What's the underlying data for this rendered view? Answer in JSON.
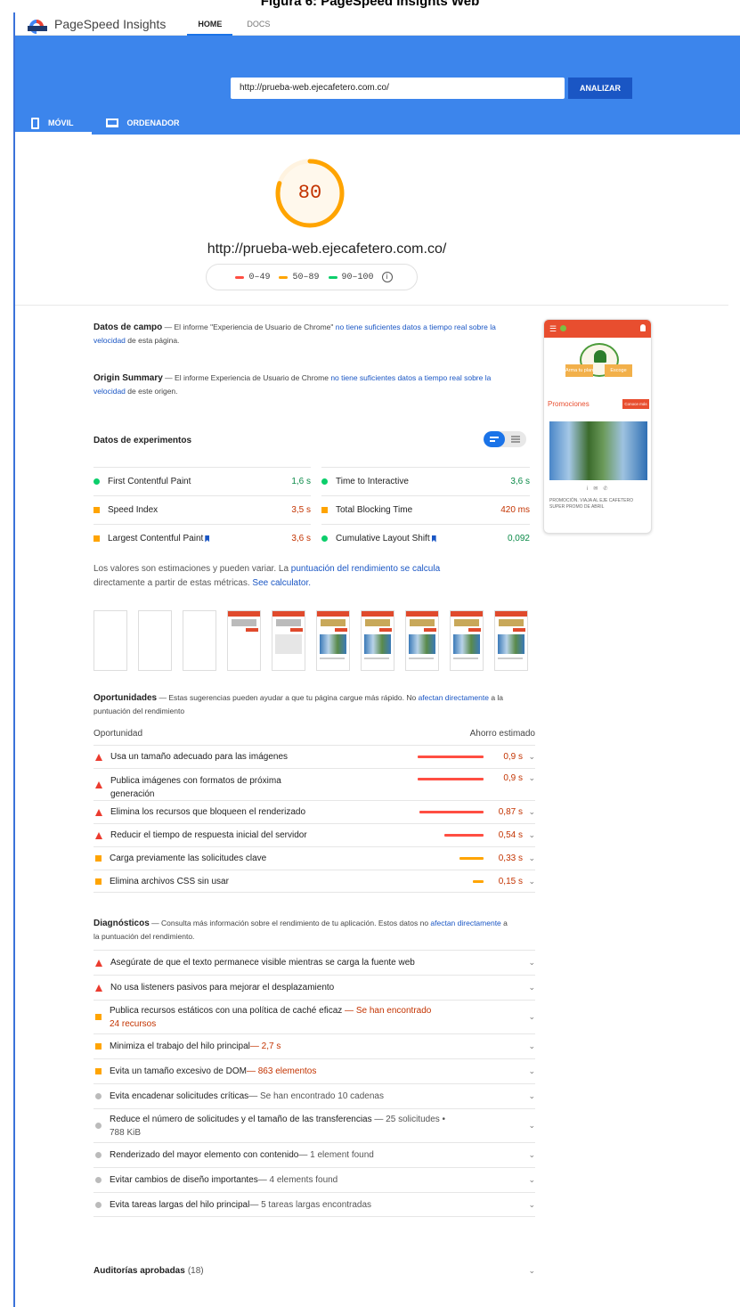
{
  "caption": "Figura 6: PageSpeed Insights Web",
  "topbar": {
    "brand": "PageSpeed Insights",
    "home": "HOME",
    "docs": "DOCS"
  },
  "search": {
    "value": "http://prueba-web.ejecafetero.com.co/",
    "button": "ANALIZAR"
  },
  "device_tabs": [
    {
      "label": "MÓVIL"
    },
    {
      "label": "ORDENADOR"
    }
  ],
  "score": {
    "value": "80",
    "fraction": 0.8,
    "color": "#ffa400",
    "url": "http://prueba-web.ejecafetero.com.co/"
  },
  "legend": [
    {
      "label": "0–49",
      "color": "#ff4e42"
    },
    {
      "label": "50–89",
      "color": "#ffa400"
    },
    {
      "label": "90–100",
      "color": "#0cce6b"
    }
  ],
  "field": {
    "title": "Datos de campo",
    "dash": " — El informe \"Experiencia de Usuario de Chrome\" ",
    "link": "no tiene suficientes datos a tiempo real sobre la velocidad",
    "tail": " de esta página."
  },
  "origin": {
    "title": "Origin Summary",
    "dash": " — El informe Experiencia de Usuario de Chrome ",
    "link": "no tiene suficientes datos a tiempo real sobre la velocidad",
    "tail": " de este origen."
  },
  "lab": {
    "title": "Datos de experimentos",
    "metrics": [
      {
        "label": "First Contentful Paint",
        "value": "1,6 s"
      },
      {
        "label": "Time to Interactive",
        "value": "3,6 s"
      },
      {
        "label": "Speed Index",
        "value": "3,5 s"
      },
      {
        "label": "Total Blocking Time",
        "value": "420 ms"
      },
      {
        "label": "Largest Contentful Paint",
        "value": "3,6 s"
      },
      {
        "label": "Cumulative Layout Shift",
        "value": "0,092"
      }
    ],
    "note1": "Los valores son estimaciones y pueden variar. La ",
    "note_link": "puntuación del rendimiento se calcula",
    "note2": "directamente a partir de estas métricas. ",
    "calc_link": "See calculator."
  },
  "opportunities": {
    "title": "Oportunidades",
    "desc": " — Estas sugerencias pueden ayudar a que tu página cargue más rápido. No ",
    "link": "afectan directamente",
    "tail": " a la puntuación del rendimiento",
    "col1": "Oportunidad",
    "col2": "Ahorro estimado",
    "items": [
      {
        "label": "Usa un tamaño adecuado para las imágenes",
        "saving": "0,9 s",
        "savings_s": 0.9
      },
      {
        "label": "Publica imágenes con formatos de próxima",
        "label2": "generación",
        "saving": "0,9 s",
        "savings_s": 0.9
      },
      {
        "label": "Elimina los recursos que bloqueen el renderizado",
        "saving": "0,87 s",
        "savings_s": 0.87
      },
      {
        "label": "Reducir el tiempo de respuesta inicial del servidor",
        "saving": "0,54 s",
        "savings_s": 0.54
      },
      {
        "label": "Carga previamente las solicitudes clave",
        "saving": "0,33 s",
        "savings_s": 0.33
      },
      {
        "label": "Elimina archivos CSS sin usar",
        "saving": "0,15 s",
        "savings_s": 0.15
      }
    ]
  },
  "diagnostics": {
    "title": "Diagnósticos",
    "desc": " — Consulta más información sobre el rendimiento de tu aplicación. Estos datos no ",
    "link": "afectan directamente",
    "tail": " a la puntuación del rendimiento.",
    "items": [
      {
        "label": "Asegúrate de que el texto permanece visible mientras se carga la fuente web"
      },
      {
        "label": "No usa listeners pasivos para mejorar el desplazamiento"
      },
      {
        "label": "Publica recursos estáticos con una política de caché eficaz",
        "note": " — Se han encontrado",
        "note2": "24 recursos"
      },
      {
        "label": "Minimiza el trabajo del hilo principal",
        "note": " — 2,7 s"
      },
      {
        "label": "Evita un tamaño excesivo de DOM",
        "note": " — 863 elementos"
      },
      {
        "label": "Evita encadenar solicitudes críticas",
        "note": " — Se han encontrado 10 cadenas"
      },
      {
        "label": "Reduce el número de solicitudes y el tamaño de las transferencias",
        "note": " — 25 solicitudes •",
        "note2": "788 KiB"
      },
      {
        "label": "Renderizado del mayor elemento con contenido",
        "note": " — 1 element found"
      },
      {
        "label": "Evitar cambios de diseño importantes",
        "note": " — 4 elements found"
      },
      {
        "label": "Evita tareas largas del hilo principal",
        "note": " — 5 tareas largas encontradas"
      }
    ]
  },
  "passed": {
    "title": "Auditorías aprobadas",
    "count": "(18)"
  },
  "screenshot": {
    "logo_left": "Arma tu plan",
    "logo_right": "Escoge",
    "promo": "Promociones",
    "cta": "Conoce más",
    "caption": "PROMOCIÓN. VIAJA AL EJE CAFETERO SUPER PROMO DE ABRIL"
  }
}
